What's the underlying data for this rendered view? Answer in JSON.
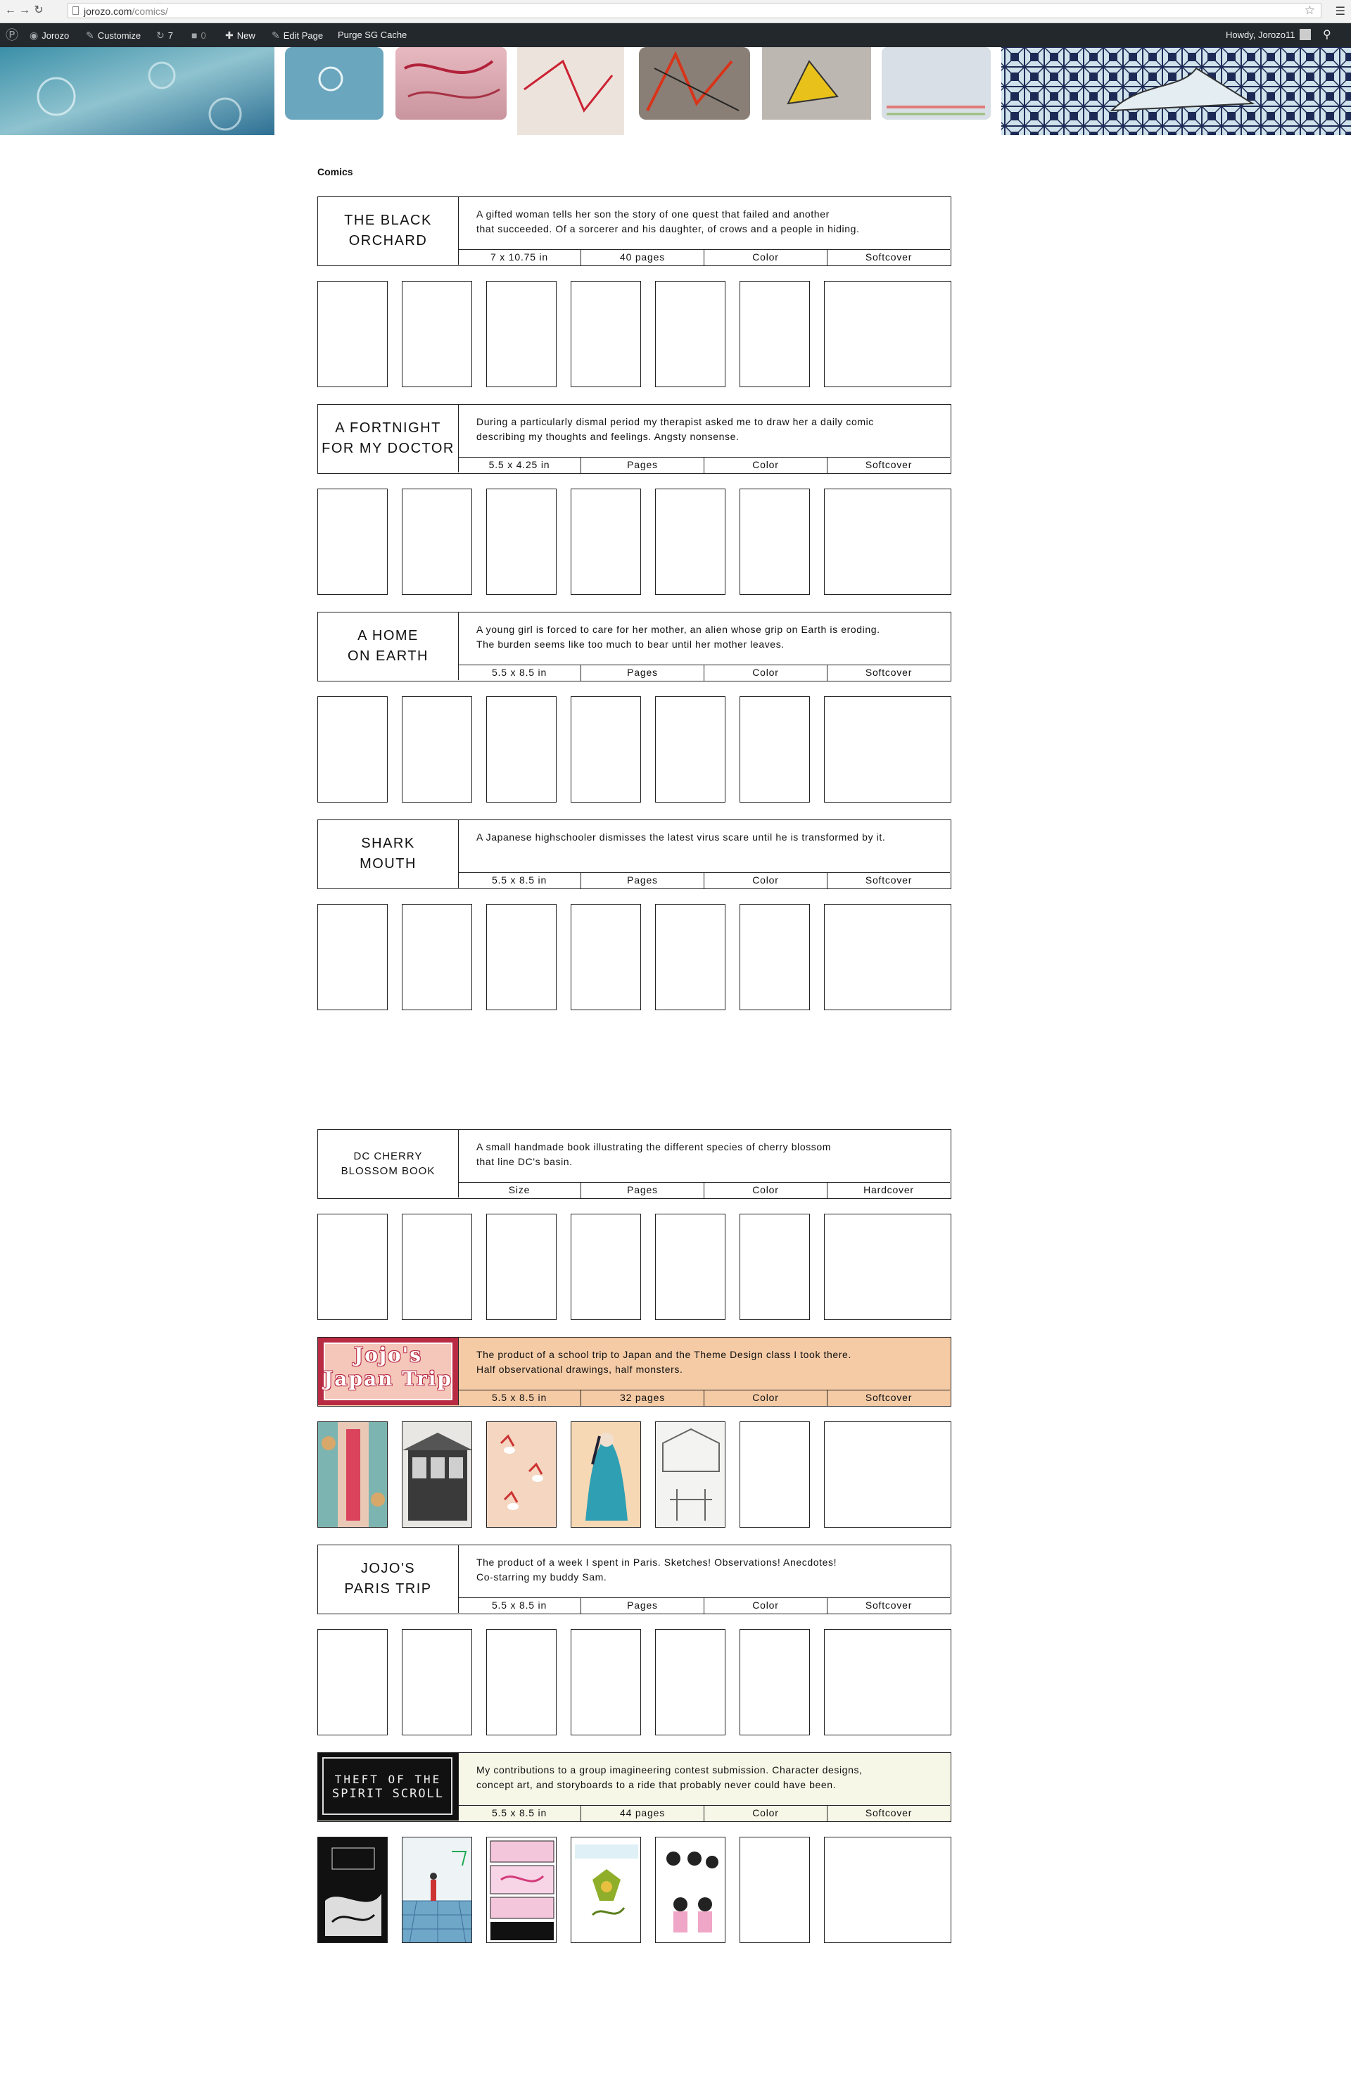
{
  "browser": {
    "url_domain": "jorozo.com",
    "url_path": "/comics/",
    "icons": [
      "back-arrow-icon",
      "forward-arrow-icon",
      "reload-icon",
      "page-icon",
      "bookmark-star-icon",
      "chrome-menu-icon"
    ]
  },
  "adminbar": {
    "site_name": "Jorozo",
    "customize": "Customize",
    "updates_count": "7",
    "comments_count": "0",
    "new": "New",
    "edit_page": "Edit Page",
    "purge_cache": "Purge SG Cache",
    "howdy": "Howdy, Jorozo11"
  },
  "page": {
    "heading": "Comics"
  },
  "comics": [
    {
      "title": "THE BLACK\nORCHARD",
      "description": "A gifted woman tells her son the story of one quest that failed and another\nthat succeeded. Of a sorcerer and his daughter, of crows and a people in hiding.",
      "size": "7 x 10.75 in",
      "pages": "40 pages",
      "color": "Color",
      "binding": "Softcover"
    },
    {
      "title": "A FORTNIGHT\nFOR MY DOCTOR",
      "description": "During a particularly dismal period my therapist asked me to draw her a daily comic\ndescribing my thoughts and feelings. Angsty nonsense.",
      "size": "5.5 x 4.25 in",
      "pages": "Pages",
      "color": "Color",
      "binding": "Softcover"
    },
    {
      "title": "A HOME\nON EARTH",
      "description": "A young girl is forced to care for her mother, an alien whose grip on Earth is eroding.\nThe burden seems like too much to bear until her mother leaves.",
      "size": "5.5 x 8.5 in",
      "pages": "Pages",
      "color": "Color",
      "binding": "Softcover"
    },
    {
      "title": "SHARK\nMOUTH",
      "description": "A Japanese highschooler dismisses the latest virus scare until he is transformed by it.",
      "size": "5.5 x 8.5 in",
      "pages": "Pages",
      "color": "Color",
      "binding": "Softcover"
    },
    {
      "title": "DC CHERRY\nBLOSSOM BOOK",
      "description": "A small handmade book illustrating the different species of cherry blossom\nthat line DC's basin.",
      "size": "Size",
      "pages": "Pages",
      "color": "Color",
      "binding": "Hardcover"
    },
    {
      "title": "Jojo's\nJapan Trip",
      "description": "The product of a school trip to Japan and the Theme Design class I took there.\nHalf observational drawings, half monsters.",
      "size": "5.5 x 8.5 in",
      "pages": "32 pages",
      "color": "Color",
      "binding": "Softcover"
    },
    {
      "title": "JOJO'S\nPARIS TRIP",
      "description": "The product of a week I spent in Paris. Sketches! Observations! Anecdotes!\nCo-starring my buddy Sam.",
      "size": "5.5 x 8.5 in",
      "pages": "Pages",
      "color": "Color",
      "binding": "Softcover"
    },
    {
      "title": "THEFT OF THE\nSPIRIT SCROLL",
      "description": "My contributions to a group imagineering contest submission. Character designs,\nconcept art, and storyboards to a ride that probably never could have been.",
      "size": "5.5 x 8.5 in",
      "pages": "44 pages",
      "color": "Color",
      "binding": "Softcover"
    }
  ],
  "colors": {
    "adminbar_bg": "#23282d",
    "jojo_japan_bg": "#f5cba6",
    "theft_bg": "#f7f7e8"
  }
}
